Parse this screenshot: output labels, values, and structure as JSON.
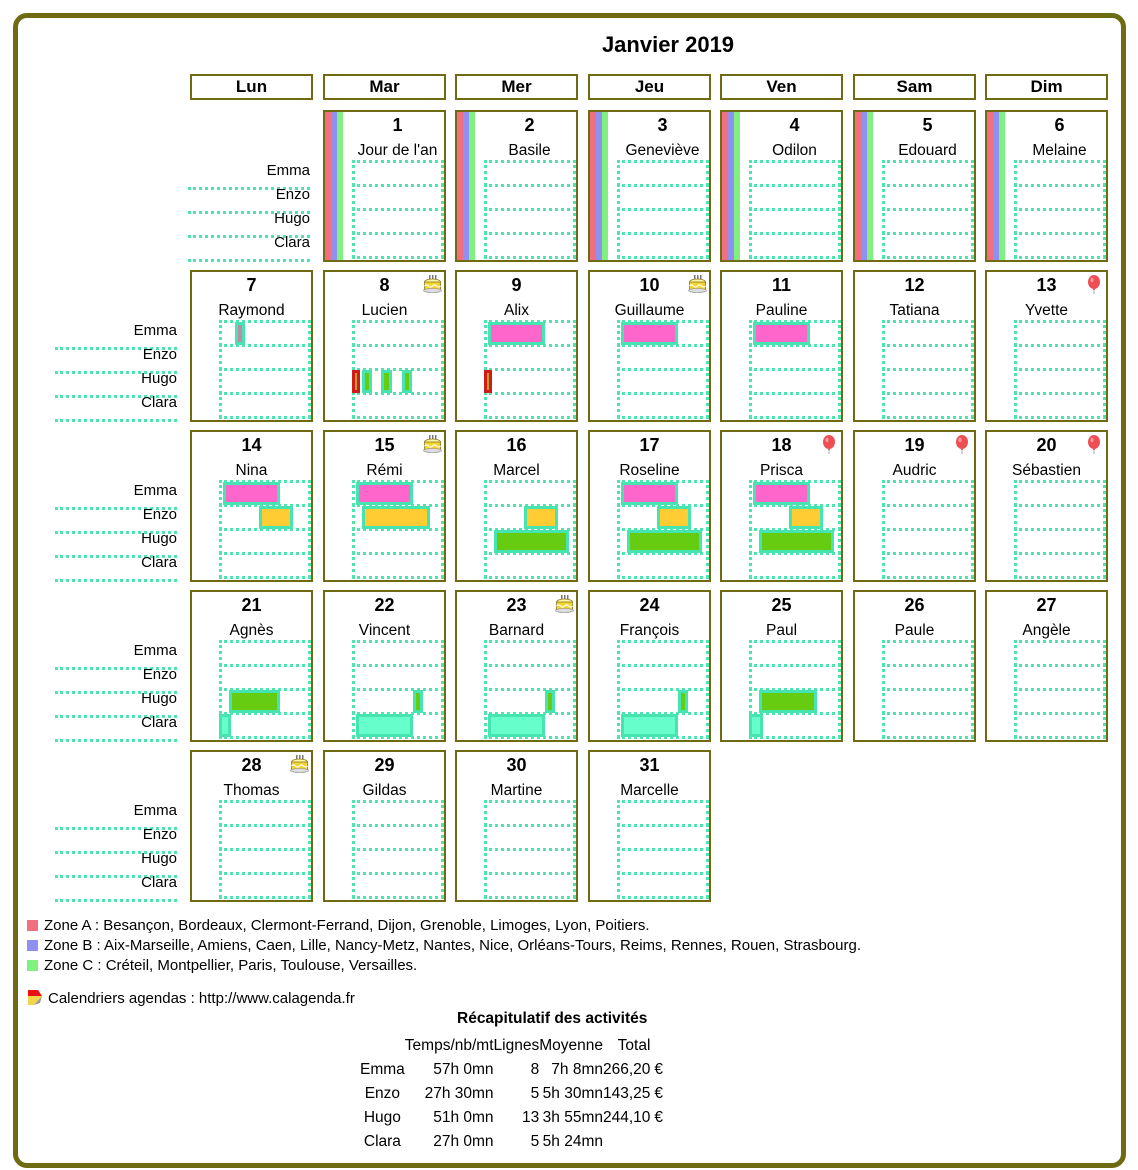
{
  "title": "Janvier 2019",
  "weekdays": [
    "Lun",
    "Mar",
    "Mer",
    "Jeu",
    "Ven",
    "Sam",
    "Dim"
  ],
  "people": [
    "Emma",
    "Enzo",
    "Hugo",
    "Clara"
  ],
  "colors": {
    "frame": "#6e6b12",
    "grid": "#4fe3b0",
    "zone_a": "#f07080",
    "zone_b": "#9090f0",
    "zone_c": "#80f080",
    "emma": "#ff66cc",
    "enzo": "#ffcc33",
    "hugo": "#66cc11",
    "clara": "#66ffcc",
    "marker_red": "#d11b1b"
  },
  "days": [
    {
      "day": "1",
      "saint": "Jour de l'an",
      "week": 0,
      "col": 1,
      "zones": true,
      "icon": null
    },
    {
      "day": "2",
      "saint": "Basile",
      "week": 0,
      "col": 2,
      "zones": true,
      "icon": null
    },
    {
      "day": "3",
      "saint": "Geneviève",
      "week": 0,
      "col": 3,
      "zones": true,
      "icon": null
    },
    {
      "day": "4",
      "saint": "Odilon",
      "week": 0,
      "col": 4,
      "zones": true,
      "icon": null
    },
    {
      "day": "5",
      "saint": "Edouard",
      "week": 0,
      "col": 5,
      "zones": true,
      "icon": null
    },
    {
      "day": "6",
      "saint": "Melaine",
      "week": 0,
      "col": 6,
      "zones": true,
      "icon": null
    },
    {
      "day": "7",
      "saint": "Raymond",
      "week": 1,
      "col": 0,
      "icon": null,
      "activities": [
        {
          "person": "Emma",
          "start": 0.17,
          "end": 0.25,
          "kind": "marker"
        }
      ]
    },
    {
      "day": "8",
      "saint": "Lucien",
      "week": 1,
      "col": 1,
      "icon": "birthday-cake",
      "activities": [
        {
          "person": "Hugo",
          "start": 0.0,
          "end": 0.09,
          "kind": "red-marker"
        },
        {
          "person": "Hugo",
          "start": 0.11,
          "end": 0.22,
          "kind": "bar"
        },
        {
          "person": "Hugo",
          "start": 0.32,
          "end": 0.43,
          "kind": "bar"
        },
        {
          "person": "Hugo",
          "start": 0.54,
          "end": 0.65,
          "kind": "bar"
        }
      ]
    },
    {
      "day": "9",
      "saint": "Alix",
      "week": 1,
      "col": 2,
      "icon": null,
      "activities": [
        {
          "person": "Emma",
          "start": 0.04,
          "end": 0.66,
          "kind": "bar"
        },
        {
          "person": "Hugo",
          "start": 0.0,
          "end": 0.09,
          "kind": "red-marker"
        }
      ]
    },
    {
      "day": "10",
      "saint": "Guillaume",
      "week": 1,
      "col": 3,
      "icon": "birthday-cake",
      "activities": [
        {
          "person": "Emma",
          "start": 0.04,
          "end": 0.66,
          "kind": "bar"
        }
      ]
    },
    {
      "day": "11",
      "saint": "Pauline",
      "week": 1,
      "col": 4,
      "icon": null,
      "activities": [
        {
          "person": "Emma",
          "start": 0.04,
          "end": 0.66,
          "kind": "bar"
        }
      ]
    },
    {
      "day": "12",
      "saint": "Tatiana",
      "week": 1,
      "col": 5,
      "icon": null
    },
    {
      "day": "13",
      "saint": "Yvette",
      "week": 1,
      "col": 6,
      "icon": "balloon"
    },
    {
      "day": "14",
      "saint": "Nina",
      "week": 2,
      "col": 0,
      "icon": null,
      "activities": [
        {
          "person": "Emma",
          "start": 0.04,
          "end": 0.66,
          "kind": "bar"
        },
        {
          "person": "Enzo",
          "start": 0.44,
          "end": 0.8,
          "kind": "bar"
        }
      ]
    },
    {
      "day": "15",
      "saint": "Rémi",
      "week": 2,
      "col": 1,
      "icon": "birthday-cake",
      "activities": [
        {
          "person": "Emma",
          "start": 0.04,
          "end": 0.66,
          "kind": "bar"
        },
        {
          "person": "Enzo",
          "start": 0.11,
          "end": 0.85,
          "kind": "bar"
        }
      ]
    },
    {
      "day": "16",
      "saint": "Marcel",
      "week": 2,
      "col": 2,
      "icon": null,
      "activities": [
        {
          "person": "Enzo",
          "start": 0.44,
          "end": 0.8,
          "kind": "bar"
        },
        {
          "person": "Hugo",
          "start": 0.11,
          "end": 0.92,
          "kind": "bar"
        }
      ]
    },
    {
      "day": "17",
      "saint": "Roseline",
      "week": 2,
      "col": 3,
      "icon": null,
      "activities": [
        {
          "person": "Emma",
          "start": 0.04,
          "end": 0.66,
          "kind": "bar"
        },
        {
          "person": "Enzo",
          "start": 0.44,
          "end": 0.8,
          "kind": "bar"
        },
        {
          "person": "Hugo",
          "start": 0.11,
          "end": 0.92,
          "kind": "bar"
        }
      ]
    },
    {
      "day": "18",
      "saint": "Prisca",
      "week": 2,
      "col": 4,
      "icon": "balloon",
      "activities": [
        {
          "person": "Emma",
          "start": 0.04,
          "end": 0.66,
          "kind": "bar"
        },
        {
          "person": "Enzo",
          "start": 0.44,
          "end": 0.8,
          "kind": "bar"
        },
        {
          "person": "Hugo",
          "start": 0.11,
          "end": 0.92,
          "kind": "bar"
        }
      ]
    },
    {
      "day": "19",
      "saint": "Audric",
      "week": 2,
      "col": 5,
      "icon": "balloon"
    },
    {
      "day": "20",
      "saint": "Sébastien",
      "week": 2,
      "col": 6,
      "icon": "balloon"
    },
    {
      "day": "21",
      "saint": "Agnès",
      "week": 3,
      "col": 0,
      "icon": null,
      "activities": [
        {
          "person": "Hugo",
          "start": 0.11,
          "end": 0.66,
          "kind": "bar"
        },
        {
          "person": "Clara",
          "start": 0.0,
          "end": 0.13,
          "kind": "bar"
        }
      ]
    },
    {
      "day": "22",
      "saint": "Vincent",
      "week": 3,
      "col": 1,
      "icon": null,
      "activities": [
        {
          "person": "Hugo",
          "start": 0.66,
          "end": 0.77,
          "kind": "bar"
        },
        {
          "person": "Clara",
          "start": 0.04,
          "end": 0.66,
          "kind": "bar"
        }
      ]
    },
    {
      "day": "23",
      "saint": "Barnard",
      "week": 3,
      "col": 2,
      "icon": "birthday-cake",
      "activities": [
        {
          "person": "Hugo",
          "start": 0.66,
          "end": 0.77,
          "kind": "bar"
        },
        {
          "person": "Clara",
          "start": 0.04,
          "end": 0.66,
          "kind": "bar"
        }
      ]
    },
    {
      "day": "24",
      "saint": "François",
      "week": 3,
      "col": 3,
      "icon": null,
      "activities": [
        {
          "person": "Hugo",
          "start": 0.66,
          "end": 0.77,
          "kind": "bar"
        },
        {
          "person": "Clara",
          "start": 0.04,
          "end": 0.66,
          "kind": "bar"
        }
      ]
    },
    {
      "day": "25",
      "saint": "Paul",
      "week": 3,
      "col": 4,
      "icon": null,
      "activities": [
        {
          "person": "Hugo",
          "start": 0.11,
          "end": 0.74,
          "kind": "bar"
        },
        {
          "person": "Clara",
          "start": 0.0,
          "end": 0.15,
          "kind": "bar"
        }
      ]
    },
    {
      "day": "26",
      "saint": "Paule",
      "week": 3,
      "col": 5,
      "icon": null
    },
    {
      "day": "27",
      "saint": "Angèle",
      "week": 3,
      "col": 6,
      "icon": null
    },
    {
      "day": "28",
      "saint": "Thomas",
      "week": 4,
      "col": 0,
      "icon": "birthday-cake"
    },
    {
      "day": "29",
      "saint": "Gildas",
      "week": 4,
      "col": 1,
      "icon": null
    },
    {
      "day": "30",
      "saint": "Martine",
      "week": 4,
      "col": 2,
      "icon": null
    },
    {
      "day": "31",
      "saint": "Marcelle",
      "week": 4,
      "col": 3,
      "icon": null
    }
  ],
  "legend": {
    "zone_a": "Zone A : Besançon, Bordeaux, Clermont-Ferrand, Dijon, Grenoble, Limoges, Lyon, Poitiers.",
    "zone_b": "Zone B : Aix-Marseille, Amiens, Caen, Lille, Nancy-Metz, Nantes, Nice, Orléans-Tours, Reims, Rennes, Rouen, Strasbourg.",
    "zone_c": "Zone C : Créteil, Montpellier, Paris, Toulouse, Versailles.",
    "credit": "Calendriers agendas : http://www.calagenda.fr"
  },
  "recap": {
    "title": "Récapitulatif des activités",
    "headers": [
      "",
      "Temps/nb/mt",
      "Lignes",
      "Moyenne",
      "Total",
      ""
    ],
    "rows": [
      [
        "Emma",
        "57h 0mn",
        "8",
        "7h 8mn",
        "266,20",
        "€"
      ],
      [
        "Enzo",
        "27h 30mn",
        "5",
        "5h 30mn",
        "143,25",
        "€"
      ],
      [
        "Hugo",
        "51h 0mn",
        "13",
        "3h 55mn",
        "244,10",
        "€"
      ],
      [
        "Clara",
        "27h 0mn",
        "5",
        "5h 24mn",
        "",
        ""
      ]
    ]
  }
}
